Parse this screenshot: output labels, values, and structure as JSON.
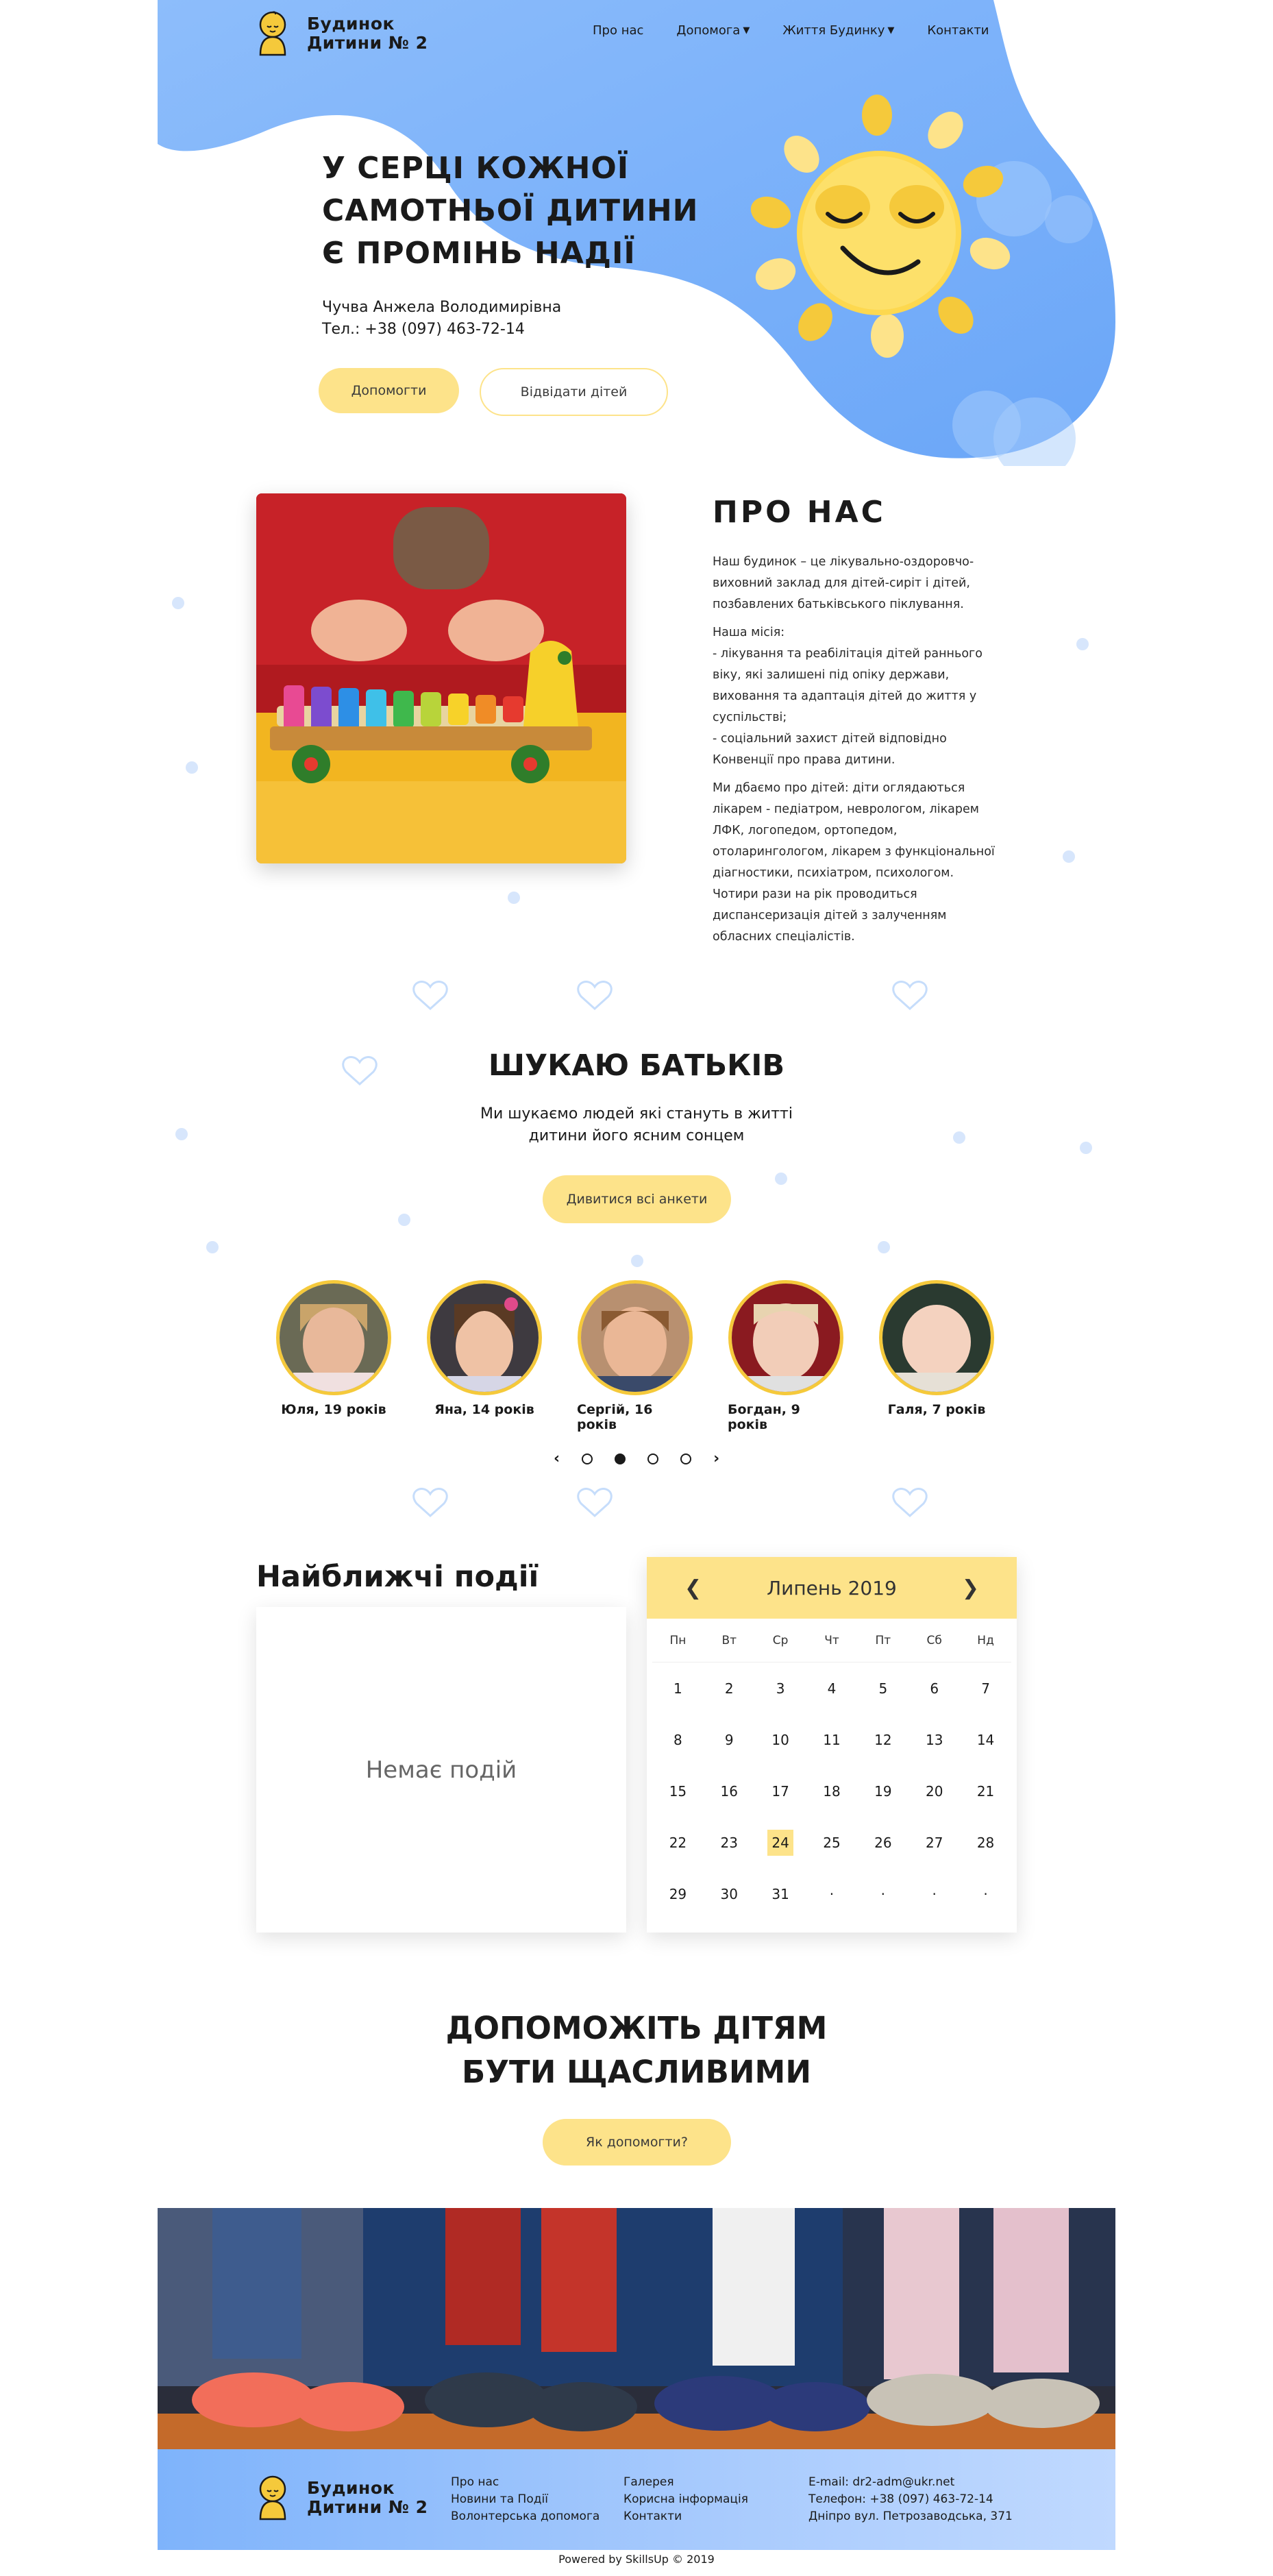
{
  "header": {
    "logo_line1": "Будинок",
    "logo_line2": "Дитини № 2",
    "nav": [
      {
        "label": "Про нас"
      },
      {
        "label": "Допомога"
      },
      {
        "label": "Життя Будинку"
      },
      {
        "label": "Контакти"
      }
    ]
  },
  "hero": {
    "title_line1": "У СЕРЦІ КОЖНОЇ",
    "title_line2": "САМОТНЬОЇ ДИТИНИ",
    "title_line3": "Є ПРОМІНЬ НАДІЇ",
    "contact_name": "Чучва Анжела Володимирівна",
    "contact_phone": "Тел.: +38 (097) 463-72-14",
    "btn_help": "Допомогти",
    "btn_visit": "Відвідати дітей"
  },
  "about": {
    "title": "ПРО НАС",
    "p1": "Наш будинок – це лікувально-оздоровчо-\nвиховний заклад для дітей-сиріт і дітей,\nпозбавлених батьківського піклування.",
    "p2": "Наша місія:\n- лікування та реабілітація дітей раннього\nвіку, які залишені під опіку держави,\nвиховання та адаптація дітей до життя у\nсуспільстві;\n- соціальний захист дітей відповідно\nКонвенції про права дитини.",
    "p3": "Ми дбаємо про дітей: діти оглядаються\nлікарем - педіатром, неврологом, лікарем\nЛФК, логопедом, ортопедом,\nотоларингологом, лікарем з функціональної\nдіагностики, психіатром, психологом.\nЧотири рази на рік проводиться\nдиспансеризація дітей з залученням\nобласних спеціалістів."
  },
  "parents": {
    "title": "ШУКАЮ БАТЬКІВ",
    "subtitle_line1": "Ми шукаємо людей які стануть в житті",
    "subtitle_line2": "дитини його ясним сонцем",
    "btn": "Дивитися всі анкети",
    "kids": [
      {
        "name": "Юля, 19 років"
      },
      {
        "name": "Яна, 14 років"
      },
      {
        "name": "Сергій, 16 років"
      },
      {
        "name": "Богдан, 9 років"
      },
      {
        "name": "Галя, 7 років"
      }
    ],
    "carousel_prev": "‹",
    "carousel_next": "›"
  },
  "events": {
    "title": "Найближчі події",
    "empty": "Немає подій"
  },
  "calendar": {
    "month": "Липень 2019",
    "prev": "❮",
    "next": "❯",
    "weekdays": [
      "Пн",
      "Вт",
      "Ср",
      "Чт",
      "Пт",
      "Сб",
      "Нд"
    ],
    "weeks": [
      [
        "1",
        "2",
        "3",
        "4",
        "5",
        "6",
        "7"
      ],
      [
        "8",
        "9",
        "10",
        "11",
        "12",
        "13",
        "14"
      ],
      [
        "15",
        "16",
        "17",
        "18",
        "19",
        "20",
        "21"
      ],
      [
        "22",
        "23",
        "24",
        "25",
        "26",
        "27",
        "28"
      ],
      [
        "29",
        "30",
        "31",
        "·",
        "·",
        "·",
        "·"
      ]
    ],
    "today": "24"
  },
  "help": {
    "title_line1": "ДОПОМОЖІТЬ ДІТЯМ",
    "title_line2": "БУТИ ЩАСЛИВИМИ",
    "btn": "Як допомогти?"
  },
  "footer": {
    "logo_line1": "Будинок",
    "logo_line2": "Дитини № 2",
    "col1": [
      "Про нас",
      "Новини та Події",
      "Волонтерська допомога"
    ],
    "col2": [
      "Галерея",
      "Корисна інформація",
      "Контакти"
    ],
    "col3": [
      "E-mail: dr2-adm@ukr.net",
      "Телефон: +38 (097) 463-72-14",
      "Дніпро вул. Петрозаводська, 371"
    ],
    "powered": "Powered by SkillsUp © 2019"
  },
  "colors": {
    "blue": "#7eb3fb",
    "yellow": "#fde38a",
    "sun": "#f5c93b"
  }
}
